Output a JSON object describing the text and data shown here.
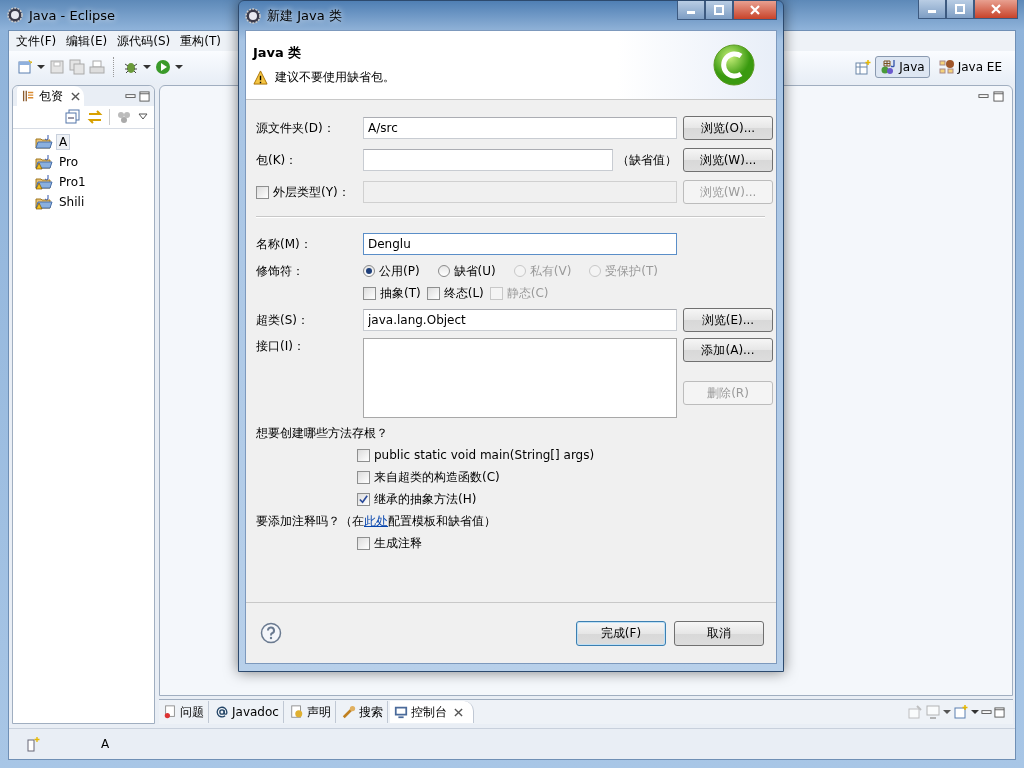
{
  "main_window": {
    "title": "Java  -  Eclipse"
  },
  "menu": [
    "文件(F)",
    "编辑(E)",
    "源代码(S)",
    "重构(T)"
  ],
  "perspectives": [
    {
      "label": "Java",
      "selected": true
    },
    {
      "label": "Java EE",
      "selected": false
    }
  ],
  "package_view": {
    "title": "包资",
    "projects": [
      {
        "name": "A",
        "selected": true,
        "warning": false
      },
      {
        "name": "Pro",
        "selected": false,
        "warning": true
      },
      {
        "name": "Pro1",
        "selected": false,
        "warning": true
      },
      {
        "name": "Shili",
        "selected": false,
        "warning": true
      }
    ]
  },
  "bottom_tabs": [
    {
      "label": "问题",
      "selected": false
    },
    {
      "label": "Javadoc",
      "selected": false
    },
    {
      "label": "声明",
      "selected": false
    },
    {
      "label": "搜索",
      "selected": false
    },
    {
      "label": "控制台",
      "selected": true
    }
  ],
  "status_bar": {
    "text": "A"
  },
  "dialog": {
    "title": "新建 Java 类",
    "heading": "Java 类",
    "message": "建议不要使用缺省包。",
    "source_folder": {
      "label": "源文件夹(D)：",
      "value": "A/src",
      "button": "浏览(O)..."
    },
    "package": {
      "label": "包(K)：",
      "hint": "（缺省值）",
      "button": "浏览(W)..."
    },
    "enclosing_type": {
      "label": "外层类型(Y)：",
      "checked": false,
      "disabled": true,
      "button": "浏览(W)..."
    },
    "name": {
      "label": "名称(M)：",
      "value": "Denglu"
    },
    "modifiers": {
      "label": "修饰符：",
      "access": [
        {
          "label": "公用(P)",
          "selected": true,
          "disabled": false
        },
        {
          "label": "缺省(U)",
          "selected": false,
          "disabled": false
        },
        {
          "label": "私有(V)",
          "selected": false,
          "disabled": true
        },
        {
          "label": "受保护(T)",
          "selected": false,
          "disabled": true
        }
      ],
      "flags": [
        {
          "label": "抽象(T)",
          "checked": false,
          "disabled": false
        },
        {
          "label": "终态(L)",
          "checked": false,
          "disabled": false
        },
        {
          "label": "静态(C)",
          "checked": false,
          "disabled": true
        }
      ]
    },
    "superclass": {
      "label": "超类(S)：",
      "value": "java.lang.Object",
      "button": "浏览(E)..."
    },
    "interfaces": {
      "label": "接口(I)：",
      "buttons": [
        {
          "label": "添加(A)...",
          "disabled": false
        },
        {
          "label": "删除(R)",
          "disabled": true
        }
      ]
    },
    "stubs": {
      "question": "想要创建哪些方法存根？",
      "options": [
        {
          "label": "public static void main(String[] args)",
          "checked": false
        },
        {
          "label": "来自超类的构造函数(C)",
          "checked": false
        },
        {
          "label": "继承的抽象方法(H)",
          "checked": true
        }
      ]
    },
    "comments": {
      "question_before": "要添加注释吗？（在",
      "link": "此处",
      "question_after": "配置模板和缺省值）",
      "options": [
        {
          "label": "生成注释",
          "checked": false
        }
      ]
    },
    "buttons": [
      {
        "label": "完成(F)",
        "default": true
      },
      {
        "label": "取消",
        "default": false
      }
    ]
  }
}
